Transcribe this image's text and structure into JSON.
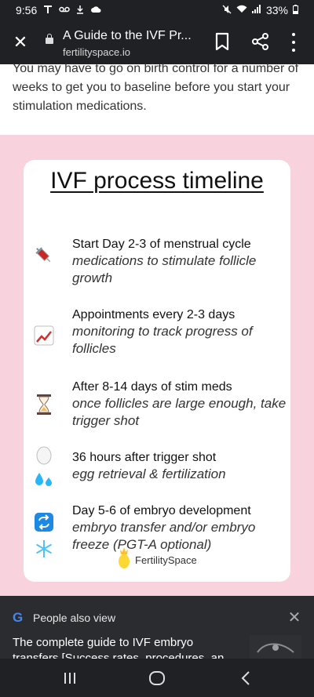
{
  "status_bar": {
    "time": "9:56",
    "left_icons": [
      "t-mobile-icon",
      "voicemail-icon",
      "download-icon",
      "cloud-icon"
    ],
    "right_icons": [
      "mute-icon",
      "wifi-icon",
      "signal-icon"
    ],
    "battery": "33%"
  },
  "top_bar": {
    "title": "A Guide to the IVF Pr...",
    "url": "fertilityspace.io"
  },
  "article": {
    "text": "You may have to go on birth control for a number of weeks to get you to baseline before you start your stimulation medications."
  },
  "infographic": {
    "title": "IVF process timeline",
    "steps": [
      {
        "heading": "Start Day 2-3 of menstrual cycle",
        "desc": "medications to stimulate follicle growth",
        "icon": "syringe-icon"
      },
      {
        "heading": "Appointments every 2-3 days",
        "desc": "monitoring to track progress of follicles",
        "icon": "chart-increasing-icon"
      },
      {
        "heading": "After 8-14 days of stim meds",
        "desc": "once follicles are large enough, take trigger shot",
        "icon": "hourglass-icon"
      },
      {
        "heading": "36 hours after trigger shot",
        "desc": "egg retrieval & fertilization",
        "icon": "egg-icon"
      },
      {
        "heading": "Day 5-6 of embryo development",
        "desc": "embryo transfer and/or embryo freeze (PGT-A optional)",
        "icon": "repeat-icon"
      }
    ],
    "logo_text": "FertilitySpace"
  },
  "bottom_sheet": {
    "label": "People also view",
    "item_title": "The complete guide to IVF embryo transfers [Success rates, procedures, an..."
  },
  "nav_bar": {
    "buttons": [
      "recents-icon",
      "home-icon",
      "back-icon"
    ]
  },
  "colors": {
    "dark_bar": "#1f2125",
    "pink_panel": "#f8d3dd",
    "google_blue": "#4285f4"
  }
}
